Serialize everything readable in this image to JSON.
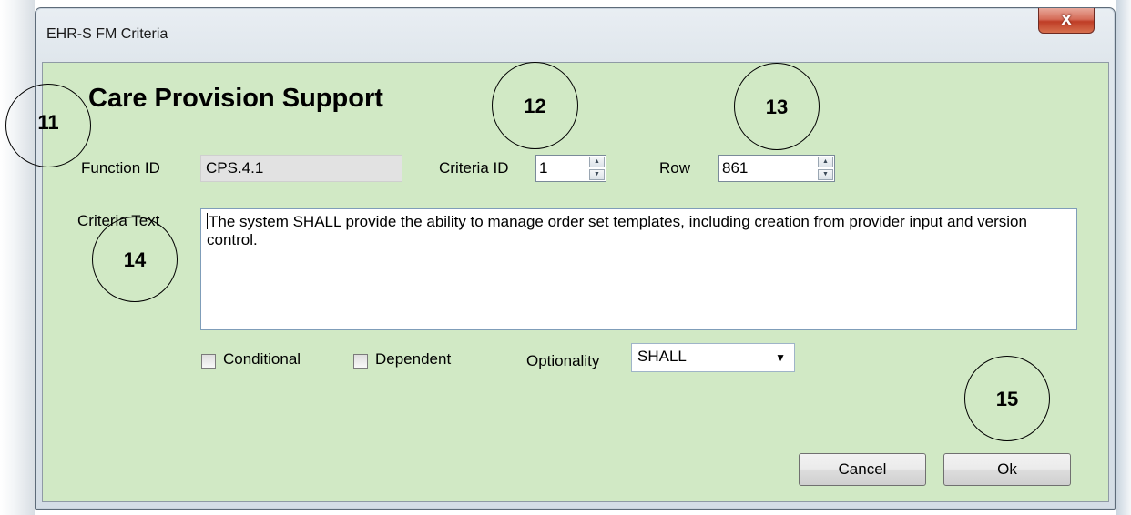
{
  "window": {
    "title": "EHR-S FM Criteria",
    "close_glyph": "X",
    "close_icon": "close-icon"
  },
  "form": {
    "heading": "Care Provision Support",
    "function_id": {
      "label": "Function ID",
      "value": "CPS.4.1"
    },
    "criteria_id": {
      "label": "Criteria ID",
      "value": "1"
    },
    "row": {
      "label": "Row",
      "value": "861"
    },
    "criteria_text": {
      "label": "Criteria Text",
      "value": "The system SHALL provide the ability to manage order set templates, including creation from provider input and version control."
    },
    "conditional": {
      "label": "Conditional",
      "checked": false
    },
    "dependent": {
      "label": "Dependent",
      "checked": false
    },
    "optionality": {
      "label": "Optionality",
      "value": "SHALL"
    }
  },
  "buttons": {
    "cancel": "Cancel",
    "ok": "Ok"
  },
  "callouts": [
    "11",
    "12",
    "13",
    "14",
    "15"
  ],
  "colors": {
    "client_background": "#d1e9c5",
    "close_button": "#c7442c"
  }
}
